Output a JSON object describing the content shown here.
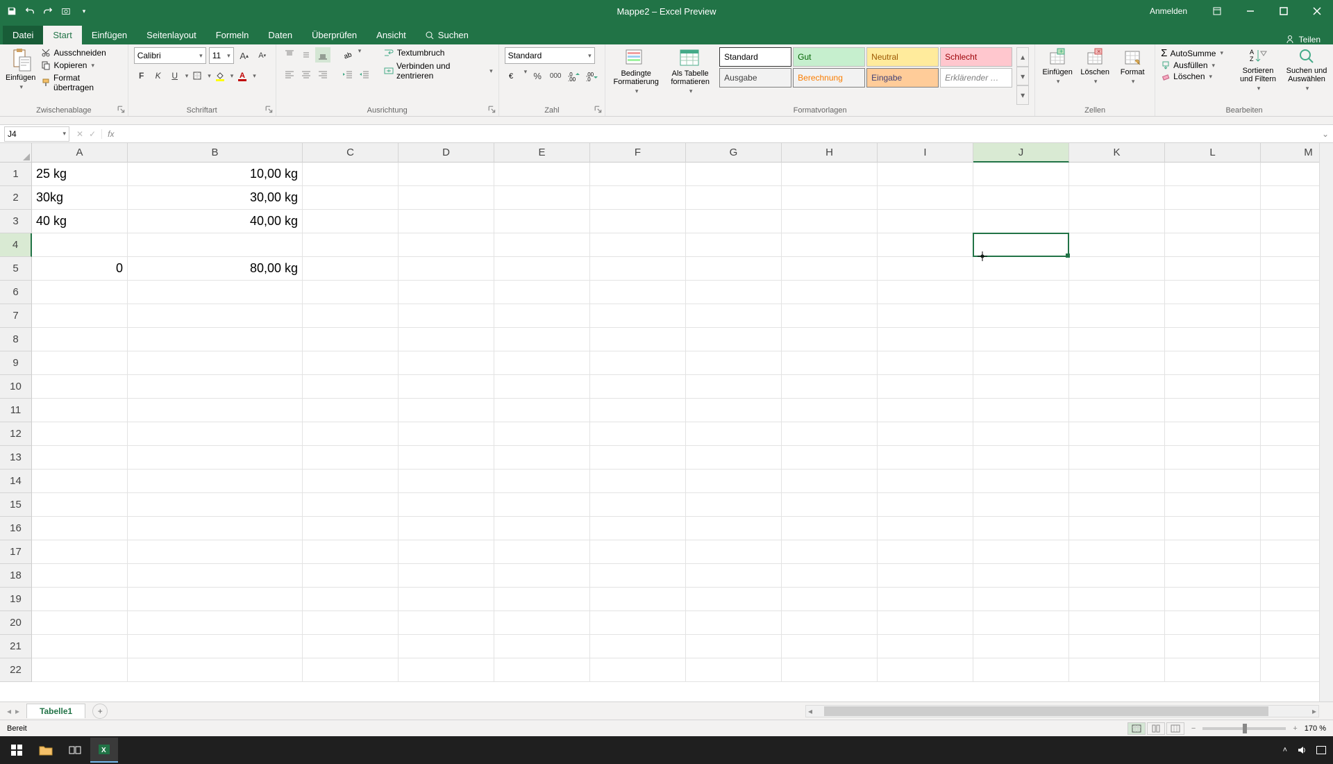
{
  "titlebar": {
    "title": "Mappe2 – Excel Preview",
    "signin": "Anmelden"
  },
  "tabs": {
    "file": "Datei",
    "items": [
      "Start",
      "Einfügen",
      "Seitenlayout",
      "Formeln",
      "Daten",
      "Überprüfen",
      "Ansicht"
    ],
    "active": "Start",
    "search_icon_label": "Suchen",
    "share": "Teilen"
  },
  "ribbon": {
    "clipboard": {
      "paste": "Einfügen",
      "cut": "Ausschneiden",
      "copy": "Kopieren",
      "format_painter": "Format übertragen",
      "group": "Zwischenablage"
    },
    "font": {
      "name": "Calibri",
      "size": "11",
      "bold": "F",
      "italic": "K",
      "underline": "U",
      "group": "Schriftart"
    },
    "alignment": {
      "wrap": "Textumbruch",
      "merge": "Verbinden und zentrieren",
      "group": "Ausrichtung"
    },
    "number": {
      "format": "Standard",
      "group": "Zahl"
    },
    "styles": {
      "cond": "Bedingte Formatierung",
      "table": "Als Tabelle formatieren",
      "gallery": [
        {
          "label": "Standard",
          "bg": "#ffffff",
          "color": "#000",
          "border": "#333"
        },
        {
          "label": "Gut",
          "bg": "#c6efce",
          "color": "#006100"
        },
        {
          "label": "Neutral",
          "bg": "#ffeb9c",
          "color": "#9c5700"
        },
        {
          "label": "Schlecht",
          "bg": "#ffc7ce",
          "color": "#9c0006"
        },
        {
          "label": "Ausgabe",
          "bg": "#f2f2f2",
          "color": "#3f3f3f",
          "border": "#7f7f7f"
        },
        {
          "label": "Berechnung",
          "bg": "#f2f2f2",
          "color": "#fa7d00",
          "border": "#7f7f7f"
        },
        {
          "label": "Eingabe",
          "bg": "#ffcc99",
          "color": "#3f3f76",
          "border": "#7f7f7f"
        },
        {
          "label": "Erklärender …",
          "bg": "#ffffff",
          "color": "#7f7f7f",
          "italic": true
        }
      ],
      "group": "Formatvorlagen"
    },
    "cells": {
      "insert": "Einfügen",
      "delete": "Löschen",
      "format": "Format",
      "group": "Zellen"
    },
    "editing": {
      "autosum": "AutoSumme",
      "fill": "Ausfüllen",
      "clear": "Löschen",
      "sort": "Sortieren und Filtern",
      "find": "Suchen und Auswählen",
      "group": "Bearbeiten"
    }
  },
  "formula_bar": {
    "name_box": "J4",
    "fx": "fx",
    "value": ""
  },
  "grid": {
    "columns": [
      "A",
      "B",
      "C",
      "D",
      "E",
      "F",
      "G",
      "H",
      "I",
      "J",
      "K",
      "L",
      "M"
    ],
    "rows": 22,
    "selected_col": "J",
    "selected_row": 4,
    "cells": {
      "A1": {
        "v": "25 kg",
        "align": "l"
      },
      "B1": {
        "v": "10,00 kg",
        "align": "r"
      },
      "A2": {
        "v": "30kg",
        "align": "l"
      },
      "B2": {
        "v": "30,00 kg",
        "align": "r"
      },
      "A3": {
        "v": "40 kg",
        "align": "l"
      },
      "B3": {
        "v": "40,00 kg",
        "align": "r"
      },
      "A5": {
        "v": "0",
        "align": "r"
      },
      "B5": {
        "v": "80,00 kg",
        "align": "r"
      }
    }
  },
  "sheets": {
    "active": "Tabelle1"
  },
  "status": {
    "ready": "Bereit",
    "zoom": "170 %"
  }
}
